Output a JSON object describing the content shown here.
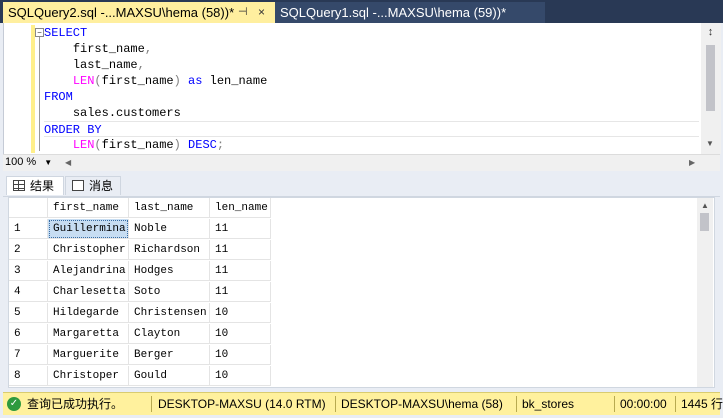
{
  "tabs": [
    {
      "label": "SQLQuery2.sql -...MAXSU\\hema (58))*",
      "pin": "⊣",
      "close": "×"
    },
    {
      "label": "SQLQuery1.sql -...MAXSU\\hema (59))*"
    }
  ],
  "editor": {
    "collapse": "−",
    "lines": [
      {
        "kw": "SELECT"
      },
      {
        "id": "first_name",
        "punct": ","
      },
      {
        "id": "last_name",
        "punct": ","
      },
      {
        "fn": "LEN",
        "paren_open": "(",
        "arg": "first_name",
        "paren_close": ")",
        "kw": "as",
        "alias": "len_name"
      },
      {
        "kw": "FROM"
      },
      {
        "id": "sales.customers"
      },
      {
        "kw": "ORDER BY"
      },
      {
        "fn": "LEN",
        "paren_open": "(",
        "arg": "first_name",
        "paren_close": ")",
        "kw": "DESC",
        "punct": ";"
      }
    ],
    "split_icon": "↕"
  },
  "zoom": {
    "value": "100 %",
    "arrow": "▼"
  },
  "result_tabs": [
    {
      "label": "结果",
      "icon": "grid-icon"
    },
    {
      "label": "消息",
      "icon": "message-icon"
    }
  ],
  "grid": {
    "columns": [
      "first_name",
      "last_name",
      "len_name"
    ],
    "rows": [
      [
        "1",
        "Guillermina",
        "Noble",
        "11"
      ],
      [
        "2",
        "Christopher",
        "Richardson",
        "11"
      ],
      [
        "3",
        "Alejandrina",
        "Hodges",
        "11"
      ],
      [
        "4",
        "Charlesetta",
        "Soto",
        "11"
      ],
      [
        "5",
        "Hildegarde",
        "Christensen",
        "10"
      ],
      [
        "6",
        "Margaretta",
        "Clayton",
        "10"
      ],
      [
        "7",
        "Marguerite",
        "Berger",
        "10"
      ],
      [
        "8",
        "Christoper",
        "Gould",
        "10"
      ]
    ]
  },
  "status": {
    "message": "查询已成功执行。",
    "server": "DESKTOP-MAXSU (14.0 RTM)",
    "user": "DESKTOP-MAXSU\\hema (58)",
    "database": "bk_stores",
    "elapsed": "00:00:00",
    "rows": "1445 行",
    "accent": "#fff19d"
  },
  "colors": {
    "tabbar": "#293955",
    "active_tab": "#ffef9f",
    "keyword": "#0000ff",
    "function": "#ff00ff"
  }
}
